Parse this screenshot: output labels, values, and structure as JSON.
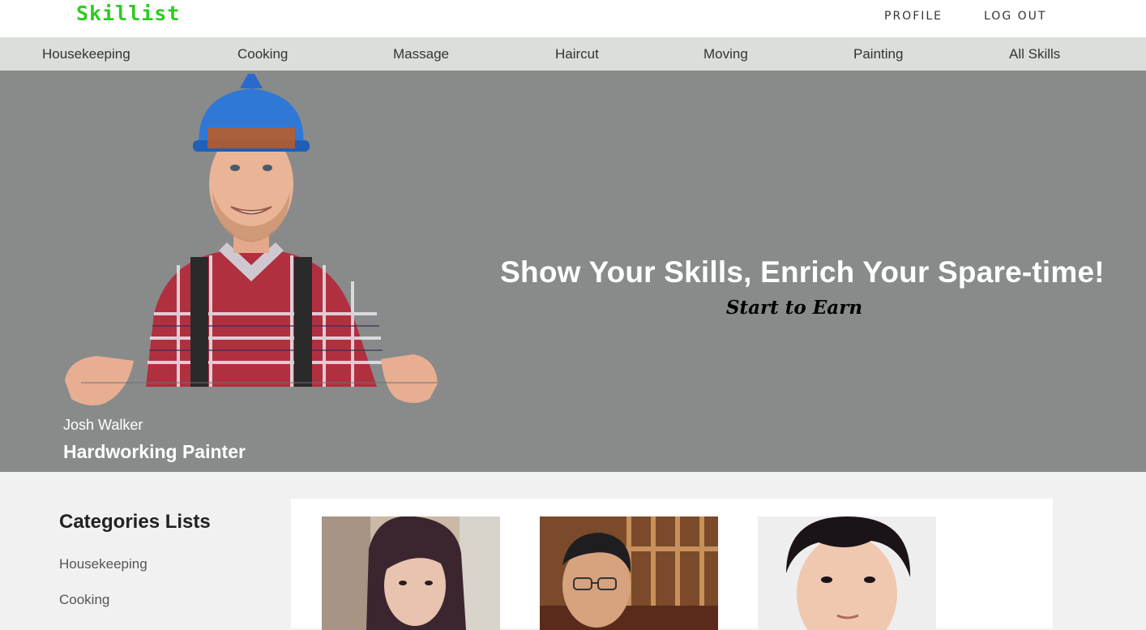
{
  "brand": {
    "name": "Skillist",
    "color": "#2bcc1f"
  },
  "header": {
    "profile_label": "PROFILE",
    "logout_label": "LOG OUT"
  },
  "categories_nav": [
    {
      "label": "Housekeeping"
    },
    {
      "label": "Cooking"
    },
    {
      "label": "Massage"
    },
    {
      "label": "Haircut"
    },
    {
      "label": "Moving"
    },
    {
      "label": "Painting"
    },
    {
      "label": "All Skills"
    }
  ],
  "hero": {
    "headline": "Show Your Skills, Enrich Your Spare-time!",
    "tagline": "Start to Earn",
    "featured": {
      "name": "Josh Walker",
      "title": "Hardworking Painter"
    }
  },
  "sidebar": {
    "title": "Categories Lists",
    "items": [
      {
        "label": "Housekeeping"
      },
      {
        "label": "Cooking"
      }
    ]
  },
  "profiles": [
    {
      "avatar": "woman-portrait"
    },
    {
      "avatar": "man-glasses-portrait"
    },
    {
      "avatar": "man-portrait"
    }
  ]
}
